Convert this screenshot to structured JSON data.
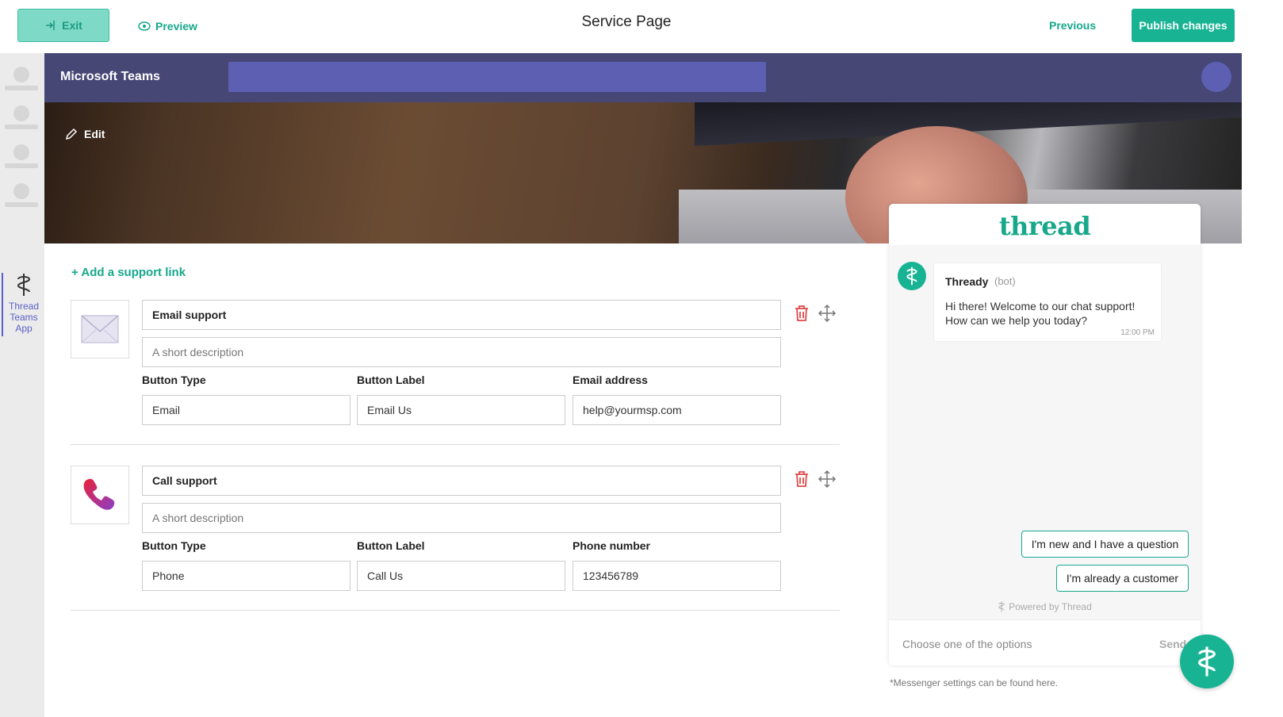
{
  "topbar": {
    "exit_label": "Exit",
    "preview_label": "Preview",
    "title": "Service Page",
    "previous_label": "Previous",
    "publish_label": "Publish changes"
  },
  "rail": {
    "app_label_1": "Thread",
    "app_label_2": "Teams",
    "app_label_3": "App"
  },
  "teams": {
    "title": "Microsoft Teams"
  },
  "hero": {
    "edit_label": "Edit"
  },
  "add_link_label": "+ Add a support link",
  "cards": [
    {
      "title": "Email support",
      "description_placeholder": "A short description",
      "col1_label": "Button Type",
      "col2_label": "Button Label",
      "col3_label": "Email address",
      "col1_value": "Email",
      "col2_value": "Email Us",
      "col3_value": "help@yourmsp.com",
      "icon": "envelope-icon"
    },
    {
      "title": "Call support",
      "description_placeholder": "A short description",
      "col1_label": "Button Type",
      "col2_label": "Button Label",
      "col3_label": "Phone number",
      "col1_value": "Phone",
      "col2_value": "Call Us",
      "col3_value": "123456789",
      "icon": "phone-icon"
    }
  ],
  "chat": {
    "logo": "thread",
    "bot_name": "Thready",
    "bot_tag": "(bot)",
    "message": "Hi there! Welcome to our chat support! How can we help you today?",
    "time": "12:00 PM",
    "option_1": "I'm new and I have a question",
    "option_2": "I'm already a customer",
    "powered": "Powered by Thread",
    "input_placeholder": "Choose one of the options",
    "send_label": "Send"
  },
  "footnote": "*Messenger settings can be found here.",
  "colors": {
    "brand": "#17b393",
    "teams_header": "#464775",
    "teams_search": "#5d5fb3",
    "danger": "#e04848"
  }
}
